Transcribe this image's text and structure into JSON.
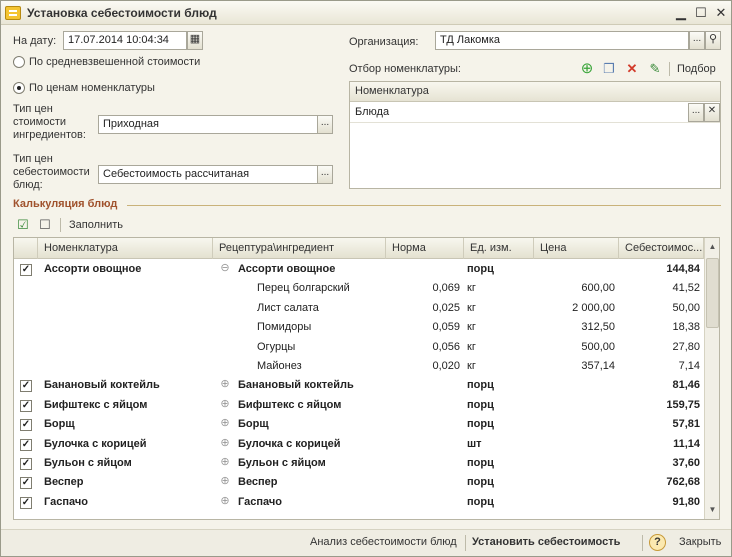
{
  "window": {
    "title": "Установка себестоимости блюд",
    "minimize": "▁",
    "maximize": "☐",
    "close": "✕"
  },
  "form": {
    "date_label": "На дату:",
    "date_value": "17.07.2014 10:04:34",
    "radio_weighted": "По средневзвешенной стоимости",
    "radio_prices": "По ценам номенклатуры",
    "radio_selected": "prices",
    "ingredient_price_label_1": "Тип цен",
    "ingredient_price_label_2": "стоимости",
    "ingredient_price_label_3": "ингредиентов:",
    "ingredient_price_value": "Приходная",
    "dish_price_label_1": "Тип цен",
    "dish_price_label_2": "себестоимости",
    "dish_price_label_3": "блюд:",
    "dish_price_value": "Себестоимость рассчитаная",
    "org_label": "Организация:",
    "org_value": "ТД Лакомка",
    "filter_label": "Отбор номенклатуры:",
    "filter_select_button": "Подбор",
    "filter_column": "Номенклатура",
    "filter_value": "Блюда"
  },
  "calc": {
    "section_title": "Калькуляция блюд",
    "fill_button": "Заполнить",
    "columns": [
      "Номенклатура",
      "Рецептура\\ингредиент",
      "Норма",
      "Ед. изм.",
      "Цена",
      "Себестоимос..."
    ],
    "rows": [
      {
        "kind": "dish",
        "checked": true,
        "name": "Ассорти овощное",
        "expand": "⊖",
        "recipe": "Ассорти овощное",
        "norm": "",
        "unit": "порц",
        "price": "",
        "cost": "144,84"
      },
      {
        "kind": "ingredient",
        "checked": false,
        "name": "",
        "expand": "",
        "recipe": "Перец болгарский",
        "norm": "0,069",
        "unit": "кг",
        "price": "600,00",
        "cost": "41,52"
      },
      {
        "kind": "ingredient",
        "checked": false,
        "name": "",
        "expand": "",
        "recipe": "Лист салата",
        "norm": "0,025",
        "unit": "кг",
        "price": "2 000,00",
        "cost": "50,00"
      },
      {
        "kind": "ingredient",
        "checked": false,
        "name": "",
        "expand": "",
        "recipe": "Помидоры",
        "norm": "0,059",
        "unit": "кг",
        "price": "312,50",
        "cost": "18,38"
      },
      {
        "kind": "ingredient",
        "checked": false,
        "name": "",
        "expand": "",
        "recipe": "Огурцы",
        "norm": "0,056",
        "unit": "кг",
        "price": "500,00",
        "cost": "27,80"
      },
      {
        "kind": "ingredient",
        "checked": false,
        "name": "",
        "expand": "",
        "recipe": "Майонез",
        "norm": "0,020",
        "unit": "кг",
        "price": "357,14",
        "cost": "7,14"
      },
      {
        "kind": "dish",
        "checked": true,
        "name": "Банановый коктейль",
        "expand": "⊕",
        "recipe": "Банановый коктейль",
        "norm": "",
        "unit": "порц",
        "price": "",
        "cost": "81,46"
      },
      {
        "kind": "dish",
        "checked": true,
        "name": "Бифштекс с яйцом",
        "expand": "⊕",
        "recipe": "Бифштекс с яйцом",
        "norm": "",
        "unit": "порц",
        "price": "",
        "cost": "159,75"
      },
      {
        "kind": "dish",
        "checked": true,
        "name": "Борщ",
        "expand": "⊕",
        "recipe": "Борщ",
        "norm": "",
        "unit": "порц",
        "price": "",
        "cost": "57,81"
      },
      {
        "kind": "dish",
        "checked": true,
        "name": "Булочка с корицей",
        "expand": "⊕",
        "recipe": "Булочка с корицей",
        "norm": "",
        "unit": "шт",
        "price": "",
        "cost": "11,14"
      },
      {
        "kind": "dish",
        "checked": true,
        "name": "Бульон с яйцом",
        "expand": "⊕",
        "recipe": "Бульон с яйцом",
        "norm": "",
        "unit": "порц",
        "price": "",
        "cost": "37,60"
      },
      {
        "kind": "dish",
        "checked": true,
        "name": "Веспер",
        "expand": "⊕",
        "recipe": "Веспер",
        "norm": "",
        "unit": "порц",
        "price": "",
        "cost": "762,68"
      },
      {
        "kind": "dish",
        "checked": true,
        "name": "Гаспачо",
        "expand": "⊕",
        "recipe": "Гаспачо",
        "norm": "",
        "unit": "порц",
        "price": "",
        "cost": "91,80"
      }
    ]
  },
  "footer": {
    "analysis": "Анализ себестоимости блюд",
    "set_cost": "Установить себестоимость",
    "help": "?",
    "close": "Закрыть"
  },
  "icons": {
    "add": "add-circle-icon",
    "copy": "copy-icon",
    "delete": "delete-icon",
    "edit": "edit-icon",
    "check_all": "check-all-icon",
    "uncheck_all": "uncheck-all-icon"
  },
  "colors": {
    "section_title": "#a0522d",
    "add_icon": "#3aa53a",
    "delete_icon": "#d23a2a"
  }
}
